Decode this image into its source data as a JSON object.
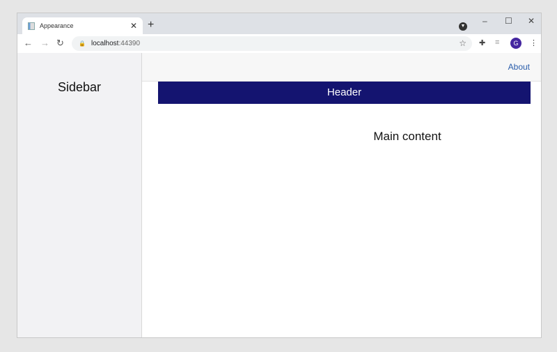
{
  "browser": {
    "tab_title": "Appearance",
    "url_host": "localhost",
    "url_port": ":44390",
    "profile_initial": "G"
  },
  "sidebar": {
    "title": "Sidebar"
  },
  "topbar": {
    "about_link": "About"
  },
  "header": {
    "title": "Header"
  },
  "main": {
    "title": "Main content"
  },
  "colors": {
    "header_bg": "#141470",
    "link": "#2a5dab"
  }
}
